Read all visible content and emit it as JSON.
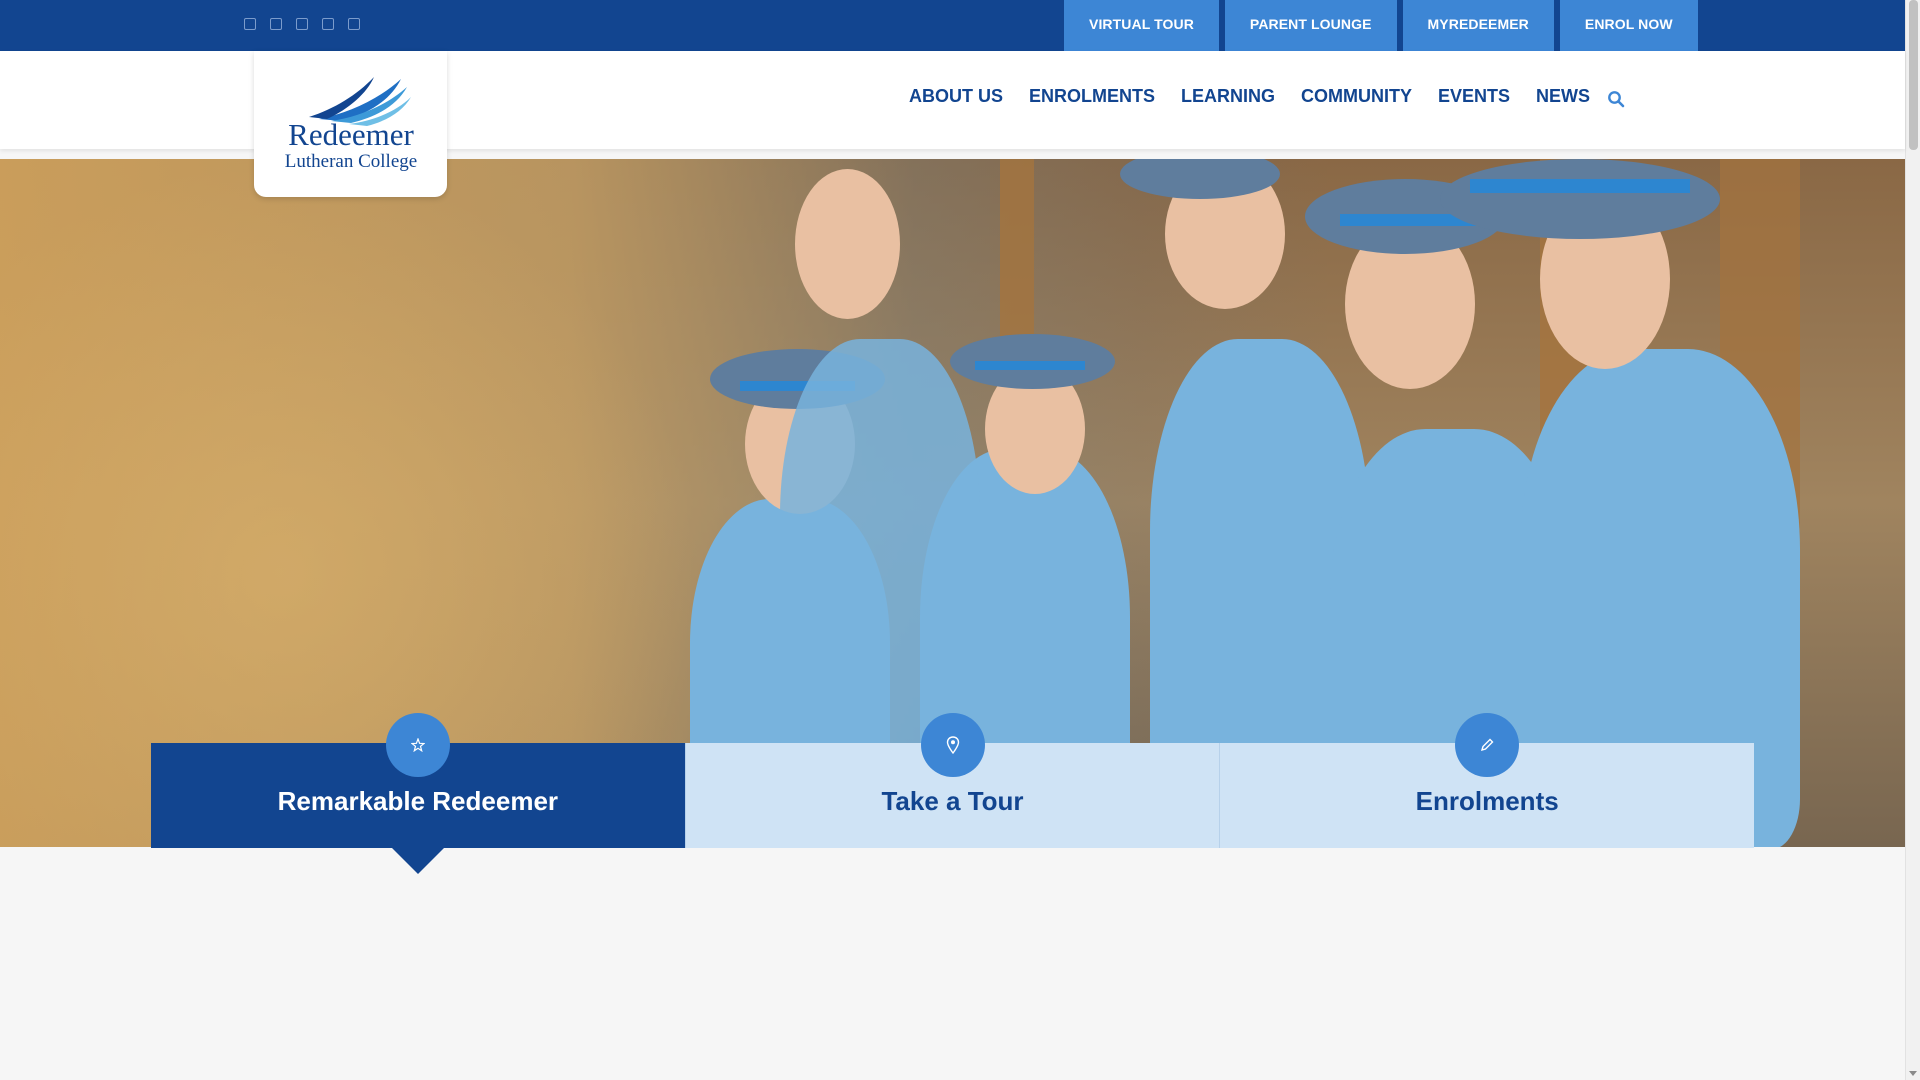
{
  "colors": {
    "navy": "#124590",
    "accent": "#3d86d5",
    "light": "#cfe3f5"
  },
  "social_icons": [
    "facebook-icon",
    "twitter-icon",
    "instagram-icon",
    "youtube-icon",
    "linkedin-icon"
  ],
  "quicklinks": [
    "VIRTUAL TOUR",
    "PARENT LOUNGE",
    "MYREDEEMER",
    "ENROL NOW"
  ],
  "logo": {
    "name": "Redeemer",
    "sub": "Lutheran College"
  },
  "nav": [
    "ABOUT US",
    "ENROLMENTS",
    "LEARNING",
    "COMMUNITY",
    "EVENTS",
    "NEWS"
  ],
  "slider": {
    "count": 5,
    "active_index": 2
  },
  "features": [
    {
      "label": "Remarkable Redeemer",
      "icon": "star-icon",
      "active": true
    },
    {
      "label": "Take a Tour",
      "icon": "map-marker-icon",
      "active": false
    },
    {
      "label": "Enrolments",
      "icon": "pencil-icon",
      "active": false
    }
  ]
}
